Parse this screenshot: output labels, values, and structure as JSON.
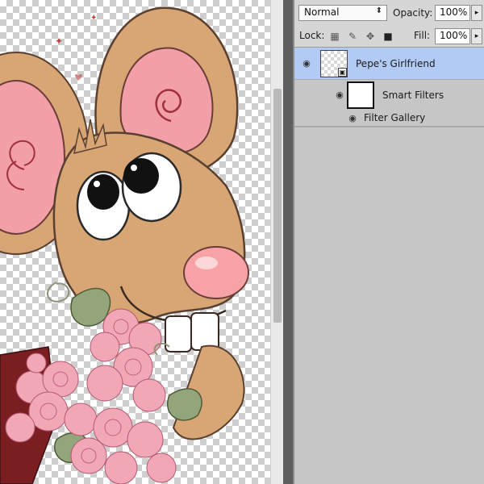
{
  "layers_panel": {
    "blend_mode": "Normal",
    "opacity_label": "Opacity:",
    "opacity_value": "100%",
    "lock_label": "Lock:",
    "fill_label": "Fill:",
    "fill_value": "100%",
    "layers": [
      {
        "name": "Pepe's Girlfriend",
        "selected": true,
        "visible": true,
        "type": "smart-object"
      },
      {
        "name": "Smart Filters",
        "selected": false,
        "visible": true,
        "type": "smart-filters"
      },
      {
        "name": "Filter Gallery",
        "selected": false,
        "visible": true,
        "type": "filter"
      }
    ]
  },
  "icons": {
    "visibility": "eye-icon",
    "lock_transparent": "lock-transparent-pixels-icon",
    "lock_image": "brush-icon",
    "lock_position": "move-icon",
    "lock_all": "padlock-icon",
    "smart_object_badge": "smart-object-icon"
  },
  "colors": {
    "selected_layer": "#b1cbf5",
    "panel_bg": "#c6c6c6",
    "divider": "#5e5e5e"
  }
}
